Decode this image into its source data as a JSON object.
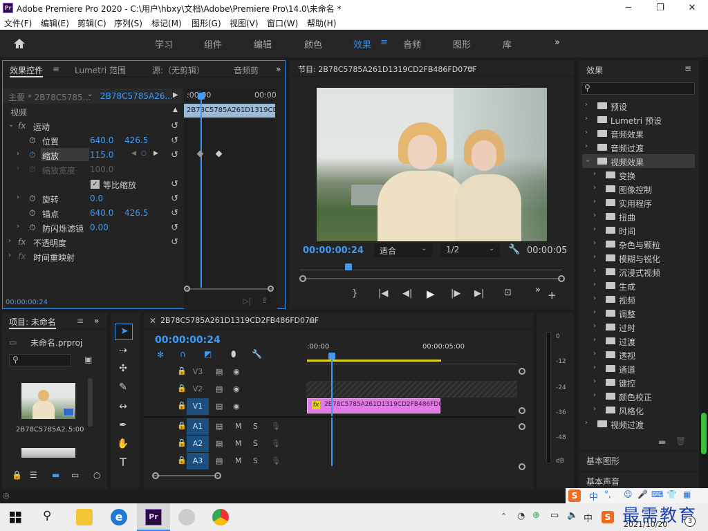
{
  "window": {
    "title": "Adobe Premiere Pro 2020 - C:\\用户\\hbxy\\文档\\Adobe\\Premiere Pro\\14.0\\未命名 *",
    "logo_text": "Pr",
    "minimize": "─",
    "maximize": "❐",
    "close": "✕"
  },
  "menu": [
    "文件(F)",
    "编辑(E)",
    "剪辑(C)",
    "序列(S)",
    "标记(M)",
    "图形(G)",
    "视图(V)",
    "窗口(W)",
    "帮助(H)"
  ],
  "workspaces": {
    "tabs": [
      "学习",
      "组件",
      "编辑",
      "颜色",
      "效果",
      "音频",
      "图形",
      "库"
    ],
    "active": "效果",
    "more": "»",
    "home_icon": "home-icon"
  },
  "effect_controls": {
    "tabs": [
      "效果控件",
      "Lumetri 范围",
      "源:（无剪辑）",
      "音频剪"
    ],
    "master_label": "主要 * 2B78C5785...",
    "clip_label": "2B78C5785A26...",
    "timeline_start": ":00:00",
    "timeline_end": "00:00",
    "clip_bar": "2B78C5785A261D1319CD",
    "section_video": "视频",
    "motion": "运动",
    "position_label": "位置",
    "position_x": "640.0",
    "position_y": "426.5",
    "scale_label": "缩放",
    "scale_value": "115.0",
    "scale_width_label": "缩放宽度",
    "scale_width_value": "100.0",
    "uniform_scale": "等比缩放",
    "rotation_label": "旋转",
    "rotation_value": "0.0",
    "anchor_label": "锚点",
    "anchor_x": "640.0",
    "anchor_y": "426.5",
    "flicker_label": "防闪烁滤镜",
    "flicker_value": "0.00",
    "opacity": "不透明度",
    "time_remap": "时间重映射",
    "timecode": "00:00:00:24"
  },
  "program": {
    "title": "节目: 2B78C5785A261D1319CD2FB486FD070F",
    "timecode": "00:00:00:24",
    "fit": "适合",
    "resolution": "1/2",
    "duration": "00:00:05"
  },
  "effects_panel": {
    "title": "效果",
    "items": [
      {
        "label": "预设",
        "level": 0
      },
      {
        "label": "Lumetri 预设",
        "level": 0
      },
      {
        "label": "音频效果",
        "level": 0
      },
      {
        "label": "音频过渡",
        "level": 0
      },
      {
        "label": "视频效果",
        "level": 0,
        "expanded": true
      },
      {
        "label": "变换",
        "level": 1
      },
      {
        "label": "图像控制",
        "level": 1
      },
      {
        "label": "实用程序",
        "level": 1
      },
      {
        "label": "扭曲",
        "level": 1
      },
      {
        "label": "时间",
        "level": 1
      },
      {
        "label": "杂色与颗粒",
        "level": 1
      },
      {
        "label": "模糊与锐化",
        "level": 1
      },
      {
        "label": "沉浸式视频",
        "level": 1
      },
      {
        "label": "生成",
        "level": 1
      },
      {
        "label": "视频",
        "level": 1
      },
      {
        "label": "调整",
        "level": 1
      },
      {
        "label": "过时",
        "level": 1
      },
      {
        "label": "过渡",
        "level": 1
      },
      {
        "label": "透视",
        "level": 1
      },
      {
        "label": "通道",
        "level": 1
      },
      {
        "label": "键控",
        "level": 1
      },
      {
        "label": "颜色校正",
        "level": 1
      },
      {
        "label": "风格化",
        "level": 1
      },
      {
        "label": "视频过渡",
        "level": 0
      }
    ],
    "basic_graphics": "基本图形",
    "basic_sound": "基本声音"
  },
  "project": {
    "title": "项目: 未命名",
    "file": "未命名.prproj",
    "clip_name": "2B78C5785A2...",
    "clip_duration": "5:00"
  },
  "timeline": {
    "title": "2B78C5785A261D1319CD2FB486FD070F",
    "timecode": "00:00:00:24",
    "ruler_start": ":00:00",
    "ruler_mid": "00:00:05:00",
    "clip": "2B78C5785A261D1319CD2FB486FD07",
    "tracks": [
      "V3",
      "V2",
      "V1",
      "A1",
      "A2",
      "A3"
    ],
    "mute": "M",
    "solo": "S"
  },
  "meter": {
    "labels": [
      "0",
      "-12",
      "-24",
      "-36",
      "-48",
      "dB"
    ]
  },
  "ime": {
    "chars": [
      "中",
      "°,",
      "☺",
      "🎤",
      "⌨",
      "👕",
      "▦"
    ]
  },
  "taskbar": {
    "date": "2021/10/20",
    "ime_mode": "中",
    "notif_count": "3",
    "watermark": "最需教育"
  },
  "colors": {
    "accent": "#2d8ceb",
    "clip": "#e27ae6",
    "panel": "#232323",
    "track_on": "#1c4f7d"
  }
}
